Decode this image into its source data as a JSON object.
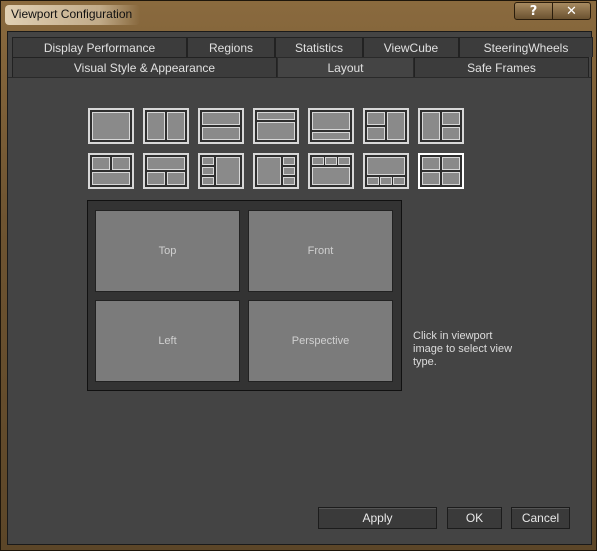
{
  "window": {
    "title": "Viewport Configuration",
    "help_label": "?",
    "close_label": "✕"
  },
  "tabs_row1": [
    {
      "label": "Display Performance"
    },
    {
      "label": "Regions"
    },
    {
      "label": "Statistics"
    },
    {
      "label": "ViewCube"
    },
    {
      "label": "SteeringWheels"
    }
  ],
  "tabs_row2": [
    {
      "label": "Visual Style & Appearance"
    },
    {
      "label": "Layout",
      "active": true
    },
    {
      "label": "Safe Frames"
    }
  ],
  "layout": {
    "selected_preset_index": 13,
    "presets_count": 14
  },
  "viewports": {
    "top_left": "Top",
    "top_right": "Front",
    "bottom_left": "Left",
    "bottom_right": "Perspective"
  },
  "hint": "Click in viewport image to select view type.",
  "buttons": {
    "apply": "Apply",
    "ok": "OK",
    "cancel": "Cancel"
  }
}
